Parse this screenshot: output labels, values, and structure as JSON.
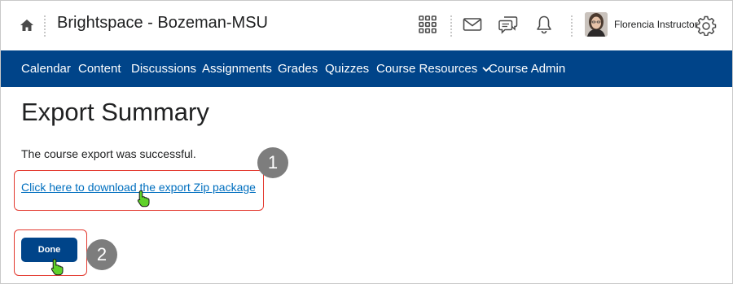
{
  "header": {
    "app_title": "Brightspace - Bozeman-MSU",
    "user_name": "Florencia Instructor",
    "icons": [
      "home-icon",
      "waffle-icon",
      "mail-icon",
      "chat-icon",
      "bell-icon",
      "avatar",
      "gear-icon"
    ]
  },
  "nav": {
    "items": [
      {
        "label": "Calendar"
      },
      {
        "label": "Content"
      },
      {
        "label": "Discussions"
      },
      {
        "label": "Assignments"
      },
      {
        "label": "Grades"
      },
      {
        "label": "Quizzes"
      },
      {
        "label": "Course Resources",
        "has_dropdown": true
      },
      {
        "label": "Course Admin"
      }
    ]
  },
  "main": {
    "page_title": "Export Summary",
    "message": "The course export was successful.",
    "download_link": "Click here to download the export Zip package",
    "done_label": "Done"
  },
  "callouts": {
    "one": "1",
    "two": "2"
  },
  "colors": {
    "nav_bg": "#004489",
    "link": "#006fbf",
    "callout_border": "#e3392f",
    "badge_bg": "#7d7d7d",
    "cursor": "#5fd12a"
  }
}
